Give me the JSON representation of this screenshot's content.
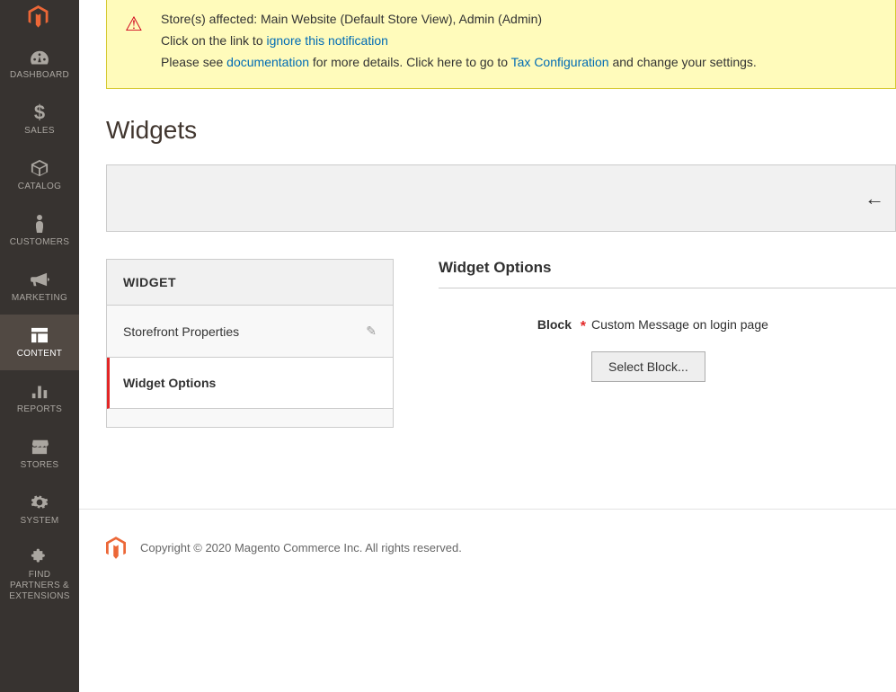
{
  "nav": {
    "items": [
      {
        "label": "DASHBOARD"
      },
      {
        "label": "SALES"
      },
      {
        "label": "CATALOG"
      },
      {
        "label": "CUSTOMERS"
      },
      {
        "label": "MARKETING"
      },
      {
        "label": "CONTENT"
      },
      {
        "label": "REPORTS"
      },
      {
        "label": "STORES"
      },
      {
        "label": "SYSTEM"
      },
      {
        "label": "FIND PARTNERS & EXTENSIONS"
      }
    ]
  },
  "notice": {
    "line1_prefix": "Store(s) affected: Main Website (Default Store View), Admin (Admin)",
    "line2_prefix": "Click on the link to ",
    "line2_link": "ignore this notification",
    "line3_prefix": "Please see ",
    "line3_link1": "documentation",
    "line3_mid": " for more details. Click here to go to ",
    "line3_link2": "Tax Configuration",
    "line3_suffix": " and change your settings."
  },
  "page": {
    "title": "Widgets"
  },
  "tabs": {
    "header": "WIDGET",
    "storefront": "Storefront Properties",
    "options": "Widget Options"
  },
  "form": {
    "section_title": "Widget Options",
    "block_label": "Block",
    "block_value": "Custom Message on login page",
    "select_button": "Select Block..."
  },
  "footer": {
    "copyright": "Copyright © 2020 Magento Commerce Inc. All rights reserved."
  }
}
